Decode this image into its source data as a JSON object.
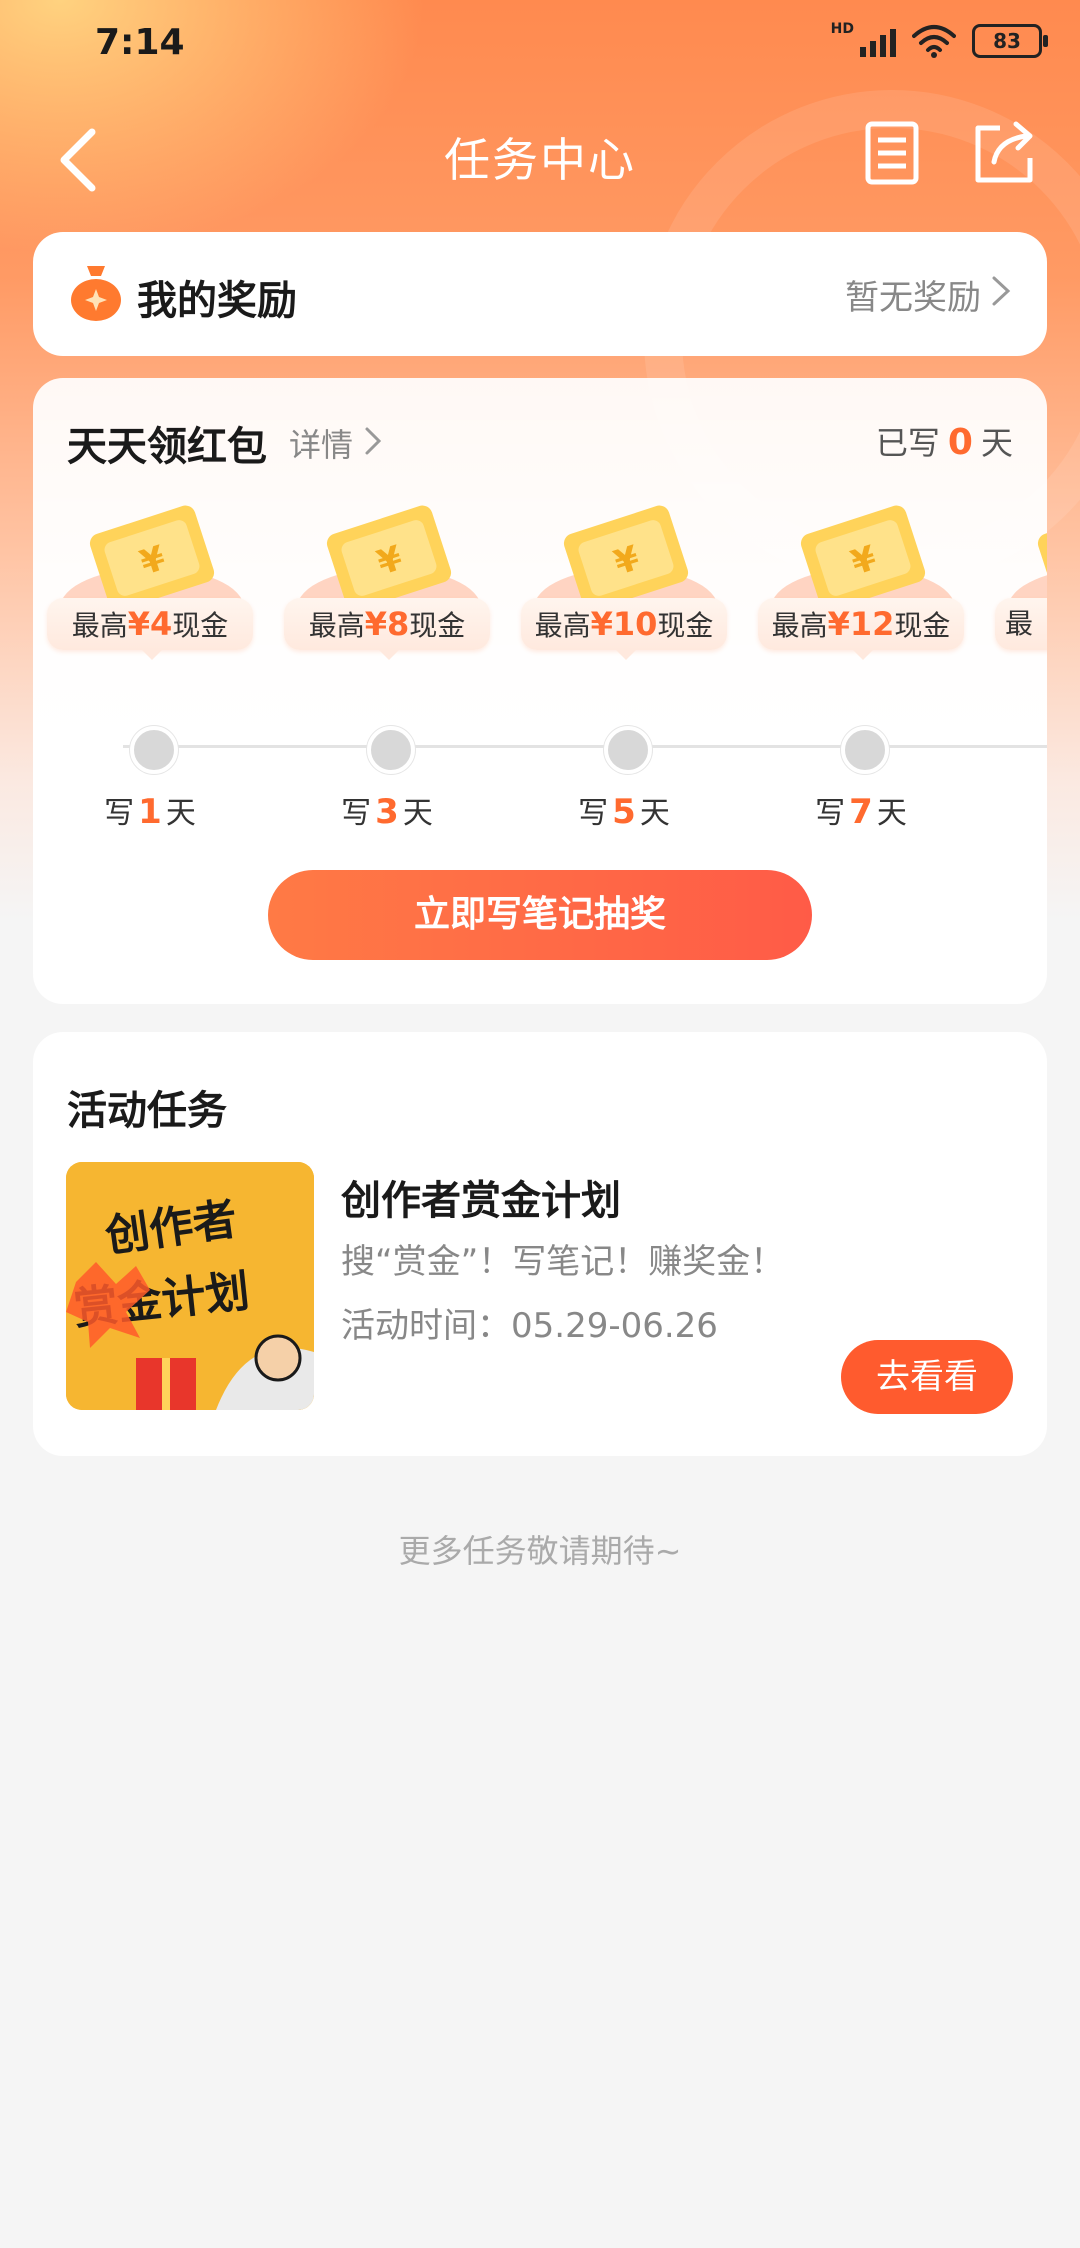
{
  "status_bar": {
    "time": "7:14",
    "network": "HD",
    "battery": "83"
  },
  "nav": {
    "title": "任务中心"
  },
  "rewards": {
    "label": "我的奖励",
    "status": "暂无奖励"
  },
  "daily": {
    "title": "天天领红包",
    "detail": "详情",
    "written_prefix": "已写",
    "written_count": "0",
    "written_suffix": "天",
    "items": [
      {
        "prefix": "最高",
        "amount": "¥4",
        "suffix": "现金",
        "day_prefix": "写",
        "day": "1",
        "day_suffix": "天"
      },
      {
        "prefix": "最高",
        "amount": "¥8",
        "suffix": "现金",
        "day_prefix": "写",
        "day": "3",
        "day_suffix": "天"
      },
      {
        "prefix": "最高",
        "amount": "¥10",
        "suffix": "现金",
        "day_prefix": "写",
        "day": "5",
        "day_suffix": "天"
      },
      {
        "prefix": "最高",
        "amount": "¥12",
        "suffix": "现金",
        "day_prefix": "写",
        "day": "7",
        "day_suffix": "天"
      },
      {
        "prefix": "最",
        "amount": "",
        "suffix": "",
        "day_prefix": "",
        "day": "",
        "day_suffix": ""
      }
    ],
    "cta": "立即写笔记抽奖"
  },
  "activity": {
    "title": "活动任务",
    "task": {
      "name": "创作者赏金计划",
      "desc": "搜“赏金”！写笔记！赚奖金！",
      "time": "活动时间：05.29-06.26",
      "button": "去看看",
      "thumb_text_top": "创作者",
      "thumb_text_bottom": "赏金计划"
    }
  },
  "footer": {
    "more": "更多任务敬请期待~"
  },
  "colors": {
    "accent": "#ff6a2f",
    "button": "#ff5b2e"
  }
}
